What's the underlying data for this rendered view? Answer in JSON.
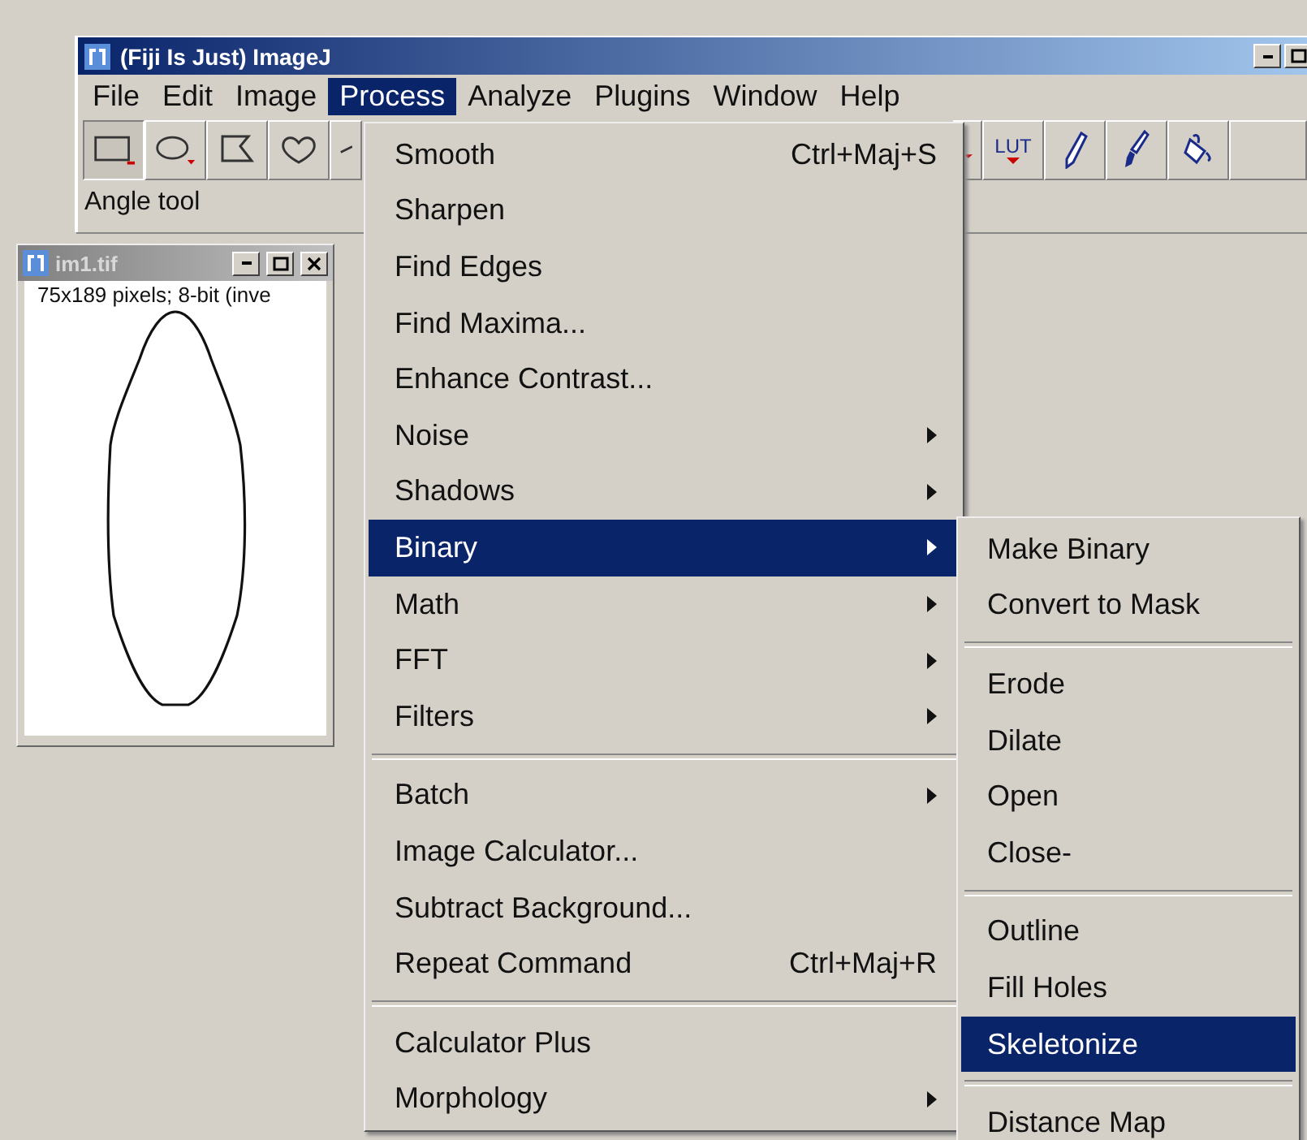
{
  "main_window": {
    "title": "(Fiji Is Just) ImageJ",
    "menu_bar": [
      {
        "label": "File",
        "selected": false
      },
      {
        "label": "Edit",
        "selected": false
      },
      {
        "label": "Image",
        "selected": false
      },
      {
        "label": "Process",
        "selected": true
      },
      {
        "label": "Analyze",
        "selected": false
      },
      {
        "label": "Plugins",
        "selected": false
      },
      {
        "label": "Window",
        "selected": false
      },
      {
        "label": "Help",
        "selected": false
      }
    ],
    "left_tools": [
      {
        "kind": "rectangle",
        "selected": true
      },
      {
        "kind": "oval",
        "selected": false
      },
      {
        "kind": "polygon",
        "selected": false
      },
      {
        "kind": "freehand",
        "selected": false
      },
      {
        "kind": "line",
        "selected": false
      }
    ],
    "right_tools": [
      {
        "kind": "dropdown",
        "selected": false
      },
      {
        "kind": "lut",
        "label": "LUT",
        "selected": false
      },
      {
        "kind": "pencil",
        "selected": false
      },
      {
        "kind": "brush",
        "selected": false
      },
      {
        "kind": "fill",
        "selected": false
      },
      {
        "kind": "blank",
        "selected": false
      }
    ],
    "status": "Angle tool"
  },
  "image_window": {
    "title": "im1.tif",
    "info": "75x189 pixels; 8-bit (inve"
  },
  "process_menu": [
    {
      "kind": "item",
      "label": "Smooth",
      "shortcut": "Ctrl+Maj+S",
      "submenu": false,
      "selected": false
    },
    {
      "kind": "item",
      "label": "Sharpen",
      "submenu": false,
      "selected": false
    },
    {
      "kind": "item",
      "label": "Find Edges",
      "submenu": false,
      "selected": false
    },
    {
      "kind": "item",
      "label": "Find Maxima...",
      "submenu": false,
      "selected": false
    },
    {
      "kind": "item",
      "label": "Enhance Contrast...",
      "submenu": false,
      "selected": false
    },
    {
      "kind": "item",
      "label": "Noise",
      "submenu": true,
      "selected": false
    },
    {
      "kind": "item",
      "label": "Shadows",
      "submenu": true,
      "selected": false
    },
    {
      "kind": "item",
      "label": "Binary",
      "submenu": true,
      "selected": true
    },
    {
      "kind": "item",
      "label": "Math",
      "submenu": true,
      "selected": false
    },
    {
      "kind": "item",
      "label": "FFT",
      "submenu": true,
      "selected": false
    },
    {
      "kind": "item",
      "label": "Filters",
      "submenu": true,
      "selected": false
    },
    {
      "kind": "separator"
    },
    {
      "kind": "item",
      "label": "Batch",
      "submenu": true,
      "selected": false
    },
    {
      "kind": "item",
      "label": "Image Calculator...",
      "submenu": false,
      "selected": false
    },
    {
      "kind": "item",
      "label": "Subtract Background...",
      "submenu": false,
      "selected": false
    },
    {
      "kind": "item",
      "label": "Repeat Command",
      "shortcut": "Ctrl+Maj+R",
      "submenu": false,
      "selected": false
    },
    {
      "kind": "separator"
    },
    {
      "kind": "item",
      "label": "Calculator Plus",
      "submenu": false,
      "selected": false
    },
    {
      "kind": "item",
      "label": "Morphology",
      "submenu": true,
      "selected": false
    }
  ],
  "binary_menu": [
    {
      "kind": "item",
      "label": "Make Binary",
      "submenu": false,
      "selected": false
    },
    {
      "kind": "item",
      "label": "Convert to Mask",
      "submenu": false,
      "selected": false
    },
    {
      "kind": "separator"
    },
    {
      "kind": "item",
      "label": "Erode",
      "submenu": false,
      "selected": false
    },
    {
      "kind": "item",
      "label": "Dilate",
      "submenu": false,
      "selected": false
    },
    {
      "kind": "item",
      "label": "Open",
      "submenu": false,
      "selected": false
    },
    {
      "kind": "item",
      "label": "Close-",
      "submenu": false,
      "selected": false
    },
    {
      "kind": "separator"
    },
    {
      "kind": "item",
      "label": "Outline",
      "submenu": false,
      "selected": false
    },
    {
      "kind": "item",
      "label": "Fill Holes",
      "submenu": false,
      "selected": false
    },
    {
      "kind": "item",
      "label": "Skeletonize",
      "submenu": false,
      "selected": true
    },
    {
      "kind": "separator"
    },
    {
      "kind": "item",
      "label": "Distance Map",
      "submenu": false,
      "selected": false
    }
  ]
}
